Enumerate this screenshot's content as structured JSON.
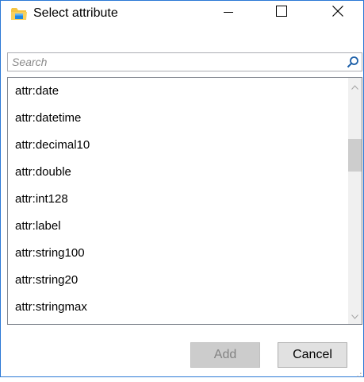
{
  "window": {
    "title": "Select attribute",
    "app_icon": "folder-app-icon",
    "controls": [
      "minimize-icon",
      "maximize-icon",
      "close-icon"
    ]
  },
  "search": {
    "placeholder": "Search",
    "value": "",
    "icon": "search-icon"
  },
  "list": {
    "items": [
      "attr:date",
      "attr:datetime",
      "attr:decimal10",
      "attr:double",
      "attr:int128",
      "attr:label",
      "attr:string100",
      "attr:string20",
      "attr:stringmax"
    ],
    "scroll_position_fraction": 0.25
  },
  "buttons": {
    "add_label": "Add",
    "add_enabled": false,
    "cancel_label": "Cancel"
  },
  "colors": {
    "window_border": "#2b79d6",
    "disabled_button_bg": "#cccccc",
    "disabled_button_text": "#838383",
    "button_bg": "#e1e1e1",
    "scroll_thumb": "#cdcdcd"
  }
}
